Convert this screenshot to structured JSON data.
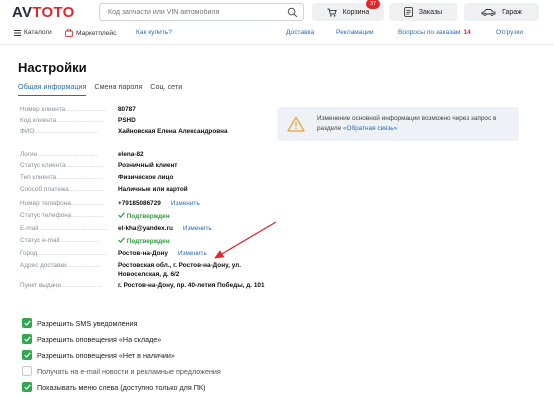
{
  "header": {
    "logo_main": "AV",
    "logo_accent": "TOTO",
    "search_placeholder": "Код запчасти или VIN автомобиля",
    "cart_label": "Корзина",
    "cart_count": "37",
    "orders_label": "Заказы",
    "garage_label": "Гараж"
  },
  "nav": {
    "catalogs": "Каталоги",
    "marketplace": "Маркетплейс",
    "how_to_buy": "Как купить?",
    "delivery": "Доставка",
    "ads": "Рекламации",
    "questions": "Вопросы по заказам",
    "questions_count": "14",
    "shipments": "Отгрузки"
  },
  "page": {
    "title": "Настройки",
    "tabs": [
      "Общая информация",
      "Смена пароля",
      "Соц. сети"
    ]
  },
  "info_box": {
    "text": "Изменение основной информации возможно через запрос в разделе ",
    "link": "«Обратная связь»"
  },
  "profile": {
    "rows": [
      {
        "label": "Номер клиента",
        "value": "80787"
      },
      {
        "label": "Код клиента",
        "value": "PSHD"
      },
      {
        "label": "ФИО",
        "value": "Хайновская Елена Александровна"
      },
      {
        "label": "Логин",
        "value": "elena-82"
      },
      {
        "label": "Статус клиента",
        "value": "Розничный клиент"
      },
      {
        "label": "Тип клиента",
        "value": "Физическое лицо"
      },
      {
        "label": "Способ платежа",
        "value": "Наличные или картой"
      },
      {
        "label": "Номер телефона",
        "value": "+79185086729",
        "link": "Изменить"
      },
      {
        "label": "Статус телефона",
        "value": "Подтвержден"
      },
      {
        "label": "E-mail",
        "value": "el-kha@yandex.ru",
        "link": "Изменить"
      },
      {
        "label": "Статус e-mail",
        "value": "Подтвержден"
      },
      {
        "label": "Город",
        "value": "Ростов-на-Дону",
        "link": "Изменить"
      },
      {
        "label": "Адрес доставки",
        "value": "Ростовская обл., г. Ростов-на-Дону, ул. Новоселская, д. 6/2"
      },
      {
        "label": "Пункт выдачи",
        "value": "г. Ростов-на-Дону, пр. 40-летия Победы, д. 101"
      }
    ]
  },
  "checkboxes": [
    {
      "label": "Разрешить SMS уведомления",
      "checked": true
    },
    {
      "label": "Разрешить оповещения «На складе»",
      "checked": true
    },
    {
      "label": "Разрешить оповещения «Нет в наличии»",
      "checked": true
    },
    {
      "label": "Получать на e-mail новости и рекламные предложения",
      "checked": false
    },
    {
      "label": "Показывать меню слева (доступно только для ПК)",
      "checked": true
    }
  ],
  "colors": {
    "accent": "#e4262c",
    "link": "#2a6fb8",
    "ok": "#2e9e3e",
    "check": "#2fa84f"
  }
}
